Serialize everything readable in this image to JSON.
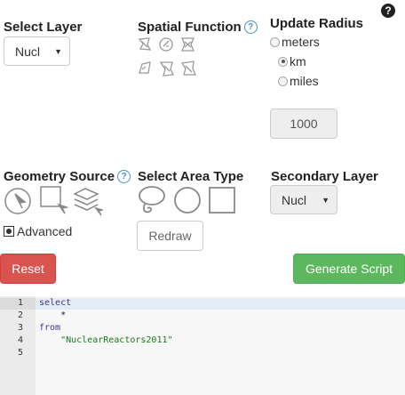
{
  "help_icon": "?",
  "select_layer": {
    "heading": "Select Layer",
    "value": "Nucl"
  },
  "spatial_function": {
    "heading": "Spatial Function",
    "icons": [
      "intersects-icon",
      "contains-icon",
      "within-icon",
      "touches-icon",
      "overlaps-icon",
      "disjoint-icon"
    ]
  },
  "update_radius": {
    "heading": "Update Radius",
    "units": [
      {
        "label": "meters",
        "checked": false
      },
      {
        "label": "km",
        "checked": true
      },
      {
        "label": "miles",
        "checked": false
      }
    ],
    "radius_value": "1000"
  },
  "geometry_source": {
    "heading": "Geometry Source",
    "icons": [
      "point-select-icon",
      "box-select-icon",
      "layers-select-icon"
    ],
    "advanced_label": "Advanced"
  },
  "select_area_type": {
    "heading": "Select Area Type",
    "icons": [
      "lasso-icon",
      "circle-icon",
      "rectangle-icon"
    ],
    "redraw_label": "Redraw"
  },
  "secondary_layer": {
    "heading": "Secondary Layer",
    "value": "Nucl"
  },
  "buttons": {
    "reset": "Reset",
    "generate": "Generate Script"
  },
  "editor": {
    "lines": [
      {
        "num": "1",
        "text": "select"
      },
      {
        "num": "2",
        "text": "    *"
      },
      {
        "num": "3",
        "text": "from"
      },
      {
        "num": "4",
        "text": "    \"NuclearReactors2011\""
      },
      {
        "num": "5",
        "text": ""
      }
    ]
  },
  "colors": {
    "help_blue": "#4a90c2",
    "reset_red": "#d9534f",
    "generate_green": "#5cb85c"
  }
}
